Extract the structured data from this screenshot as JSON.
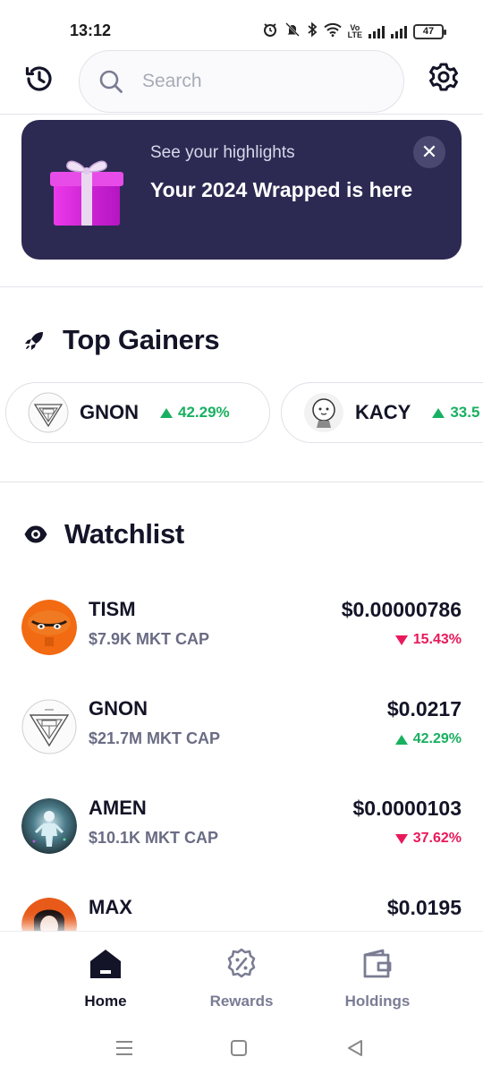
{
  "status_bar": {
    "time": "13:12",
    "battery": "47"
  },
  "search": {
    "placeholder": "Search"
  },
  "banner": {
    "subtitle": "See your highlights",
    "title": "Your 2024 Wrapped is here",
    "close_icon": "✕"
  },
  "top_gainers": {
    "title": "Top Gainers",
    "items": [
      {
        "symbol": "GNON",
        "change": "42.29%"
      },
      {
        "symbol": "KACY",
        "change": "33.5"
      }
    ]
  },
  "watchlist": {
    "title": "Watchlist",
    "items": [
      {
        "symbol": "TISM",
        "cap": "$7.9K MKT CAP",
        "price": "$0.00000786",
        "change": "15.43%",
        "direction": "down"
      },
      {
        "symbol": "GNON",
        "cap": "$21.7M MKT CAP",
        "price": "$0.0217",
        "change": "42.29%",
        "direction": "up"
      },
      {
        "symbol": "AMEN",
        "cap": "$10.1K MKT CAP",
        "price": "$0.0000103",
        "change": "37.62%",
        "direction": "down"
      },
      {
        "symbol": "MAX",
        "cap": "",
        "price": "$0.0195",
        "change": "",
        "direction": ""
      }
    ]
  },
  "nav": {
    "home": "Home",
    "rewards": "Rewards",
    "holdings": "Holdings"
  },
  "colors": {
    "banner_bg": "#2c2a52",
    "up": "#18b060",
    "down": "#e8195a",
    "text_dark": "#141428",
    "text_muted": "#6a6c84"
  }
}
